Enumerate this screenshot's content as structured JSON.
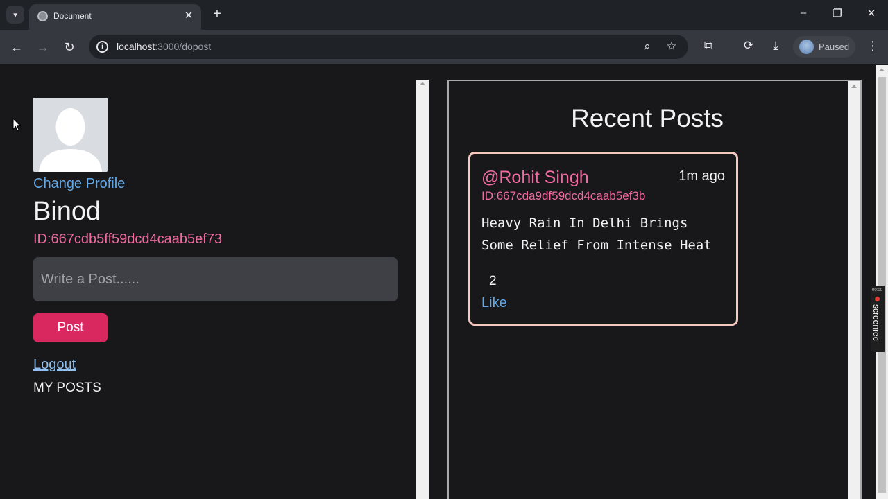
{
  "browser": {
    "tab_title": "Document",
    "url_host": "localhost",
    "url_path": ":3000/dopost",
    "profile_status": "Paused"
  },
  "profile": {
    "change_profile_label": "Change Profile",
    "name": "Binod",
    "user_id": "ID:667cdb5ff59dcd4caab5ef73",
    "post_placeholder": "Write a Post......",
    "post_button": "Post",
    "logout_label": "Logout",
    "my_posts_label": "MY POSTS"
  },
  "recent": {
    "title": "Recent Posts",
    "posts": [
      {
        "author": "@Rohit Singh",
        "time": "1m ago",
        "id": "ID:667cda9df59dcd4caab5ef3b",
        "content": "Heavy Rain In Delhi Brings Some Relief From Intense Heat",
        "likes": "2",
        "like_label": "Like"
      }
    ]
  },
  "overlay": {
    "recorder_time": "00:00",
    "recorder_label": "screenrec"
  },
  "colors": {
    "accent_pink": "#f06ba0",
    "post_button": "#d8285f",
    "link_blue": "#63a8e6",
    "card_border": "#f6c9c0"
  }
}
